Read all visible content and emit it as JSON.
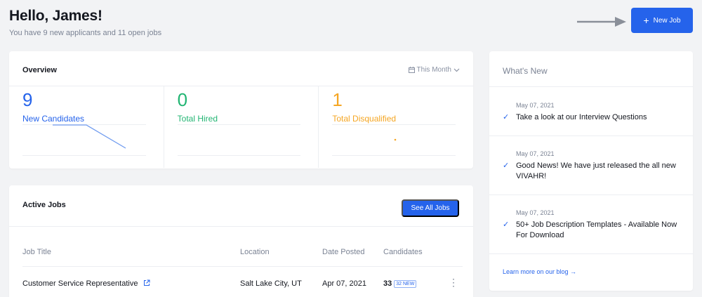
{
  "header": {
    "greeting": "Hello, James!",
    "subtitle": "You have 9 new applicants and 11 open jobs",
    "new_job_label": "New Job",
    "new_job_icon": "plus-icon"
  },
  "overview": {
    "title": "Overview",
    "period": "This Month",
    "stats": [
      {
        "value": "9",
        "label": "New Candidates",
        "color": "#2563eb"
      },
      {
        "value": "0",
        "label": "Total Hired",
        "color": "#22b573"
      },
      {
        "value": "1",
        "label": "Total Disqualified",
        "color": "#f5a623"
      }
    ]
  },
  "jobs": {
    "title": "Active Jobs",
    "see_all_label": "See All Jobs",
    "columns": [
      "Job Title",
      "Location",
      "Date Posted",
      "Candidates"
    ],
    "rows": [
      {
        "title": "Customer Service Representative",
        "location": "Salt Lake City, UT",
        "date": "Apr 07, 2021",
        "candidates": "33",
        "new_badge": "32 NEW"
      }
    ]
  },
  "whats_new": {
    "title": "What's New",
    "items": [
      {
        "date": "May 07, 2021",
        "text": "Take a look at our Interview Questions"
      },
      {
        "date": "May 07, 2021",
        "text": "Good News! We have just released the all new VIVAHR!"
      },
      {
        "date": "May 07, 2021",
        "text": "50+ Job Description Templates - Available Now For Download"
      }
    ],
    "blog_link": "Learn more on our blog →"
  },
  "colors": {
    "accent": "#2563eb",
    "hired": "#22b573",
    "disqualified": "#f5a623"
  }
}
